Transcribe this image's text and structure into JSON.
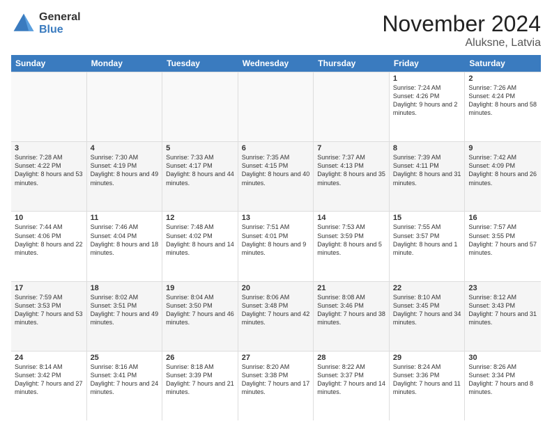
{
  "logo": {
    "general": "General",
    "blue": "Blue"
  },
  "title": "November 2024",
  "location": "Aluksne, Latvia",
  "weekdays": [
    "Sunday",
    "Monday",
    "Tuesday",
    "Wednesday",
    "Thursday",
    "Friday",
    "Saturday"
  ],
  "rows": [
    [
      {
        "day": "",
        "info": ""
      },
      {
        "day": "",
        "info": ""
      },
      {
        "day": "",
        "info": ""
      },
      {
        "day": "",
        "info": ""
      },
      {
        "day": "",
        "info": ""
      },
      {
        "day": "1",
        "info": "Sunrise: 7:24 AM\nSunset: 4:26 PM\nDaylight: 9 hours and 2 minutes."
      },
      {
        "day": "2",
        "info": "Sunrise: 7:26 AM\nSunset: 4:24 PM\nDaylight: 8 hours and 58 minutes."
      }
    ],
    [
      {
        "day": "3",
        "info": "Sunrise: 7:28 AM\nSunset: 4:22 PM\nDaylight: 8 hours and 53 minutes."
      },
      {
        "day": "4",
        "info": "Sunrise: 7:30 AM\nSunset: 4:19 PM\nDaylight: 8 hours and 49 minutes."
      },
      {
        "day": "5",
        "info": "Sunrise: 7:33 AM\nSunset: 4:17 PM\nDaylight: 8 hours and 44 minutes."
      },
      {
        "day": "6",
        "info": "Sunrise: 7:35 AM\nSunset: 4:15 PM\nDaylight: 8 hours and 40 minutes."
      },
      {
        "day": "7",
        "info": "Sunrise: 7:37 AM\nSunset: 4:13 PM\nDaylight: 8 hours and 35 minutes."
      },
      {
        "day": "8",
        "info": "Sunrise: 7:39 AM\nSunset: 4:11 PM\nDaylight: 8 hours and 31 minutes."
      },
      {
        "day": "9",
        "info": "Sunrise: 7:42 AM\nSunset: 4:09 PM\nDaylight: 8 hours and 26 minutes."
      }
    ],
    [
      {
        "day": "10",
        "info": "Sunrise: 7:44 AM\nSunset: 4:06 PM\nDaylight: 8 hours and 22 minutes."
      },
      {
        "day": "11",
        "info": "Sunrise: 7:46 AM\nSunset: 4:04 PM\nDaylight: 8 hours and 18 minutes."
      },
      {
        "day": "12",
        "info": "Sunrise: 7:48 AM\nSunset: 4:02 PM\nDaylight: 8 hours and 14 minutes."
      },
      {
        "day": "13",
        "info": "Sunrise: 7:51 AM\nSunset: 4:01 PM\nDaylight: 8 hours and 9 minutes."
      },
      {
        "day": "14",
        "info": "Sunrise: 7:53 AM\nSunset: 3:59 PM\nDaylight: 8 hours and 5 minutes."
      },
      {
        "day": "15",
        "info": "Sunrise: 7:55 AM\nSunset: 3:57 PM\nDaylight: 8 hours and 1 minute."
      },
      {
        "day": "16",
        "info": "Sunrise: 7:57 AM\nSunset: 3:55 PM\nDaylight: 7 hours and 57 minutes."
      }
    ],
    [
      {
        "day": "17",
        "info": "Sunrise: 7:59 AM\nSunset: 3:53 PM\nDaylight: 7 hours and 53 minutes."
      },
      {
        "day": "18",
        "info": "Sunrise: 8:02 AM\nSunset: 3:51 PM\nDaylight: 7 hours and 49 minutes."
      },
      {
        "day": "19",
        "info": "Sunrise: 8:04 AM\nSunset: 3:50 PM\nDaylight: 7 hours and 46 minutes."
      },
      {
        "day": "20",
        "info": "Sunrise: 8:06 AM\nSunset: 3:48 PM\nDaylight: 7 hours and 42 minutes."
      },
      {
        "day": "21",
        "info": "Sunrise: 8:08 AM\nSunset: 3:46 PM\nDaylight: 7 hours and 38 minutes."
      },
      {
        "day": "22",
        "info": "Sunrise: 8:10 AM\nSunset: 3:45 PM\nDaylight: 7 hours and 34 minutes."
      },
      {
        "day": "23",
        "info": "Sunrise: 8:12 AM\nSunset: 3:43 PM\nDaylight: 7 hours and 31 minutes."
      }
    ],
    [
      {
        "day": "24",
        "info": "Sunrise: 8:14 AM\nSunset: 3:42 PM\nDaylight: 7 hours and 27 minutes."
      },
      {
        "day": "25",
        "info": "Sunrise: 8:16 AM\nSunset: 3:41 PM\nDaylight: 7 hours and 24 minutes."
      },
      {
        "day": "26",
        "info": "Sunrise: 8:18 AM\nSunset: 3:39 PM\nDaylight: 7 hours and 21 minutes."
      },
      {
        "day": "27",
        "info": "Sunrise: 8:20 AM\nSunset: 3:38 PM\nDaylight: 7 hours and 17 minutes."
      },
      {
        "day": "28",
        "info": "Sunrise: 8:22 AM\nSunset: 3:37 PM\nDaylight: 7 hours and 14 minutes."
      },
      {
        "day": "29",
        "info": "Sunrise: 8:24 AM\nSunset: 3:36 PM\nDaylight: 7 hours and 11 minutes."
      },
      {
        "day": "30",
        "info": "Sunrise: 8:26 AM\nSunset: 3:34 PM\nDaylight: 7 hours and 8 minutes."
      }
    ]
  ]
}
